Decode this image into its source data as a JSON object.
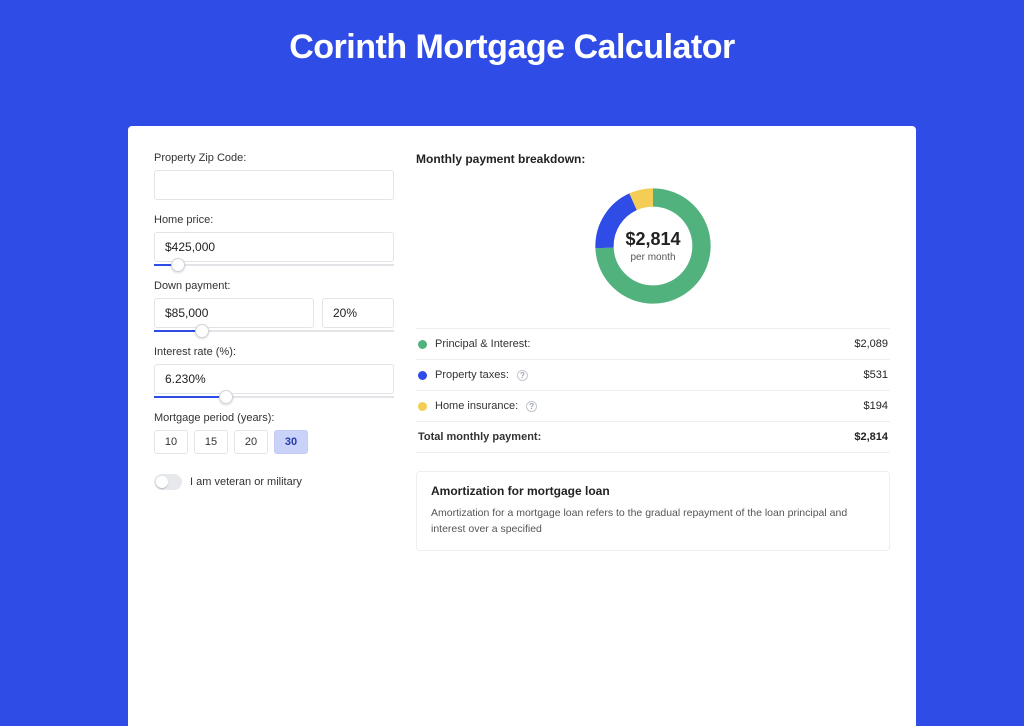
{
  "page_title": "Corinth Mortgage Calculator",
  "form": {
    "zip_label": "Property Zip Code:",
    "zip_value": "",
    "home_price_label": "Home price:",
    "home_price_value": "$425,000",
    "home_price_slider_pct": 10,
    "down_payment_label": "Down payment:",
    "down_payment_amount": "$85,000",
    "down_payment_pct": "20%",
    "down_payment_slider_pct": 20,
    "interest_label": "Interest rate (%):",
    "interest_value": "6.230%",
    "interest_slider_pct": 30,
    "period_label": "Mortgage period (years):",
    "period_options": [
      "10",
      "15",
      "20",
      "30"
    ],
    "period_selected": "30",
    "veteran_label": "I am veteran or military",
    "veteran_on": false
  },
  "breakdown": {
    "title": "Monthly payment breakdown:",
    "center_amount": "$2,814",
    "center_sub": "per month",
    "items": [
      {
        "label": "Principal & Interest:",
        "value": "$2,089",
        "color": "green",
        "info": false
      },
      {
        "label": "Property taxes:",
        "value": "$531",
        "color": "blue",
        "info": true
      },
      {
        "label": "Home insurance:",
        "value": "$194",
        "color": "yellow",
        "info": true
      }
    ],
    "total_label": "Total monthly payment:",
    "total_value": "$2,814"
  },
  "amortization": {
    "title": "Amortization for mortgage loan",
    "text": "Amortization for a mortgage loan refers to the gradual repayment of the loan principal and interest over a specified"
  },
  "chart_data": {
    "type": "pie",
    "title": "Monthly payment breakdown",
    "categories": [
      "Principal & Interest",
      "Property taxes",
      "Home insurance"
    ],
    "values": [
      2089,
      531,
      194
    ],
    "colors": [
      "#52b27d",
      "#304ce6",
      "#f4cd55"
    ],
    "total": 2814,
    "center_label": "$2,814 per month"
  }
}
